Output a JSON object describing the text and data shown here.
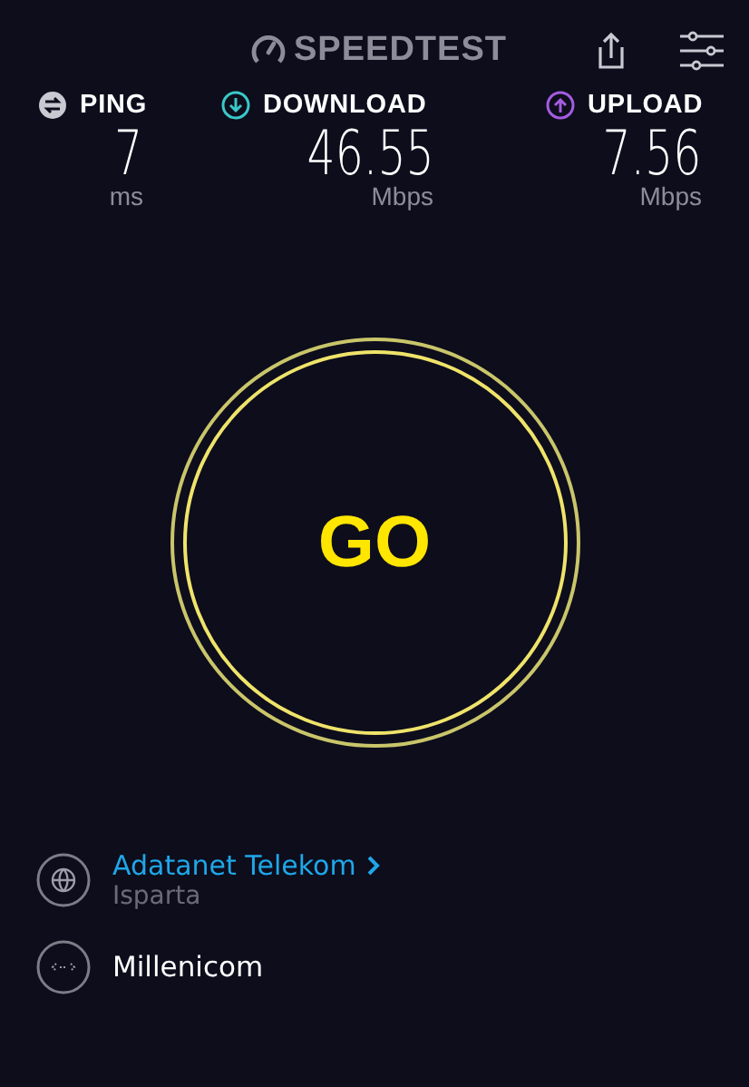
{
  "header": {
    "logo": "SPEEDTEST"
  },
  "metrics": [
    {
      "kind": "ping",
      "label": "PING",
      "value": "7",
      "unit": "ms",
      "color": "#c9c9d2"
    },
    {
      "kind": "download",
      "label": "DOWNLOAD",
      "value": "46.55",
      "unit": "Mbps",
      "color": "#3ac8c8"
    },
    {
      "kind": "upload",
      "label": "UPLOAD",
      "value": "7.56",
      "unit": "Mbps",
      "color": "#a45ce0"
    }
  ],
  "go_button": {
    "label": "GO"
  },
  "provider": {
    "name": "Adatanet Telekom",
    "location": "Isparta"
  },
  "server": {
    "name": "Millenicom"
  }
}
